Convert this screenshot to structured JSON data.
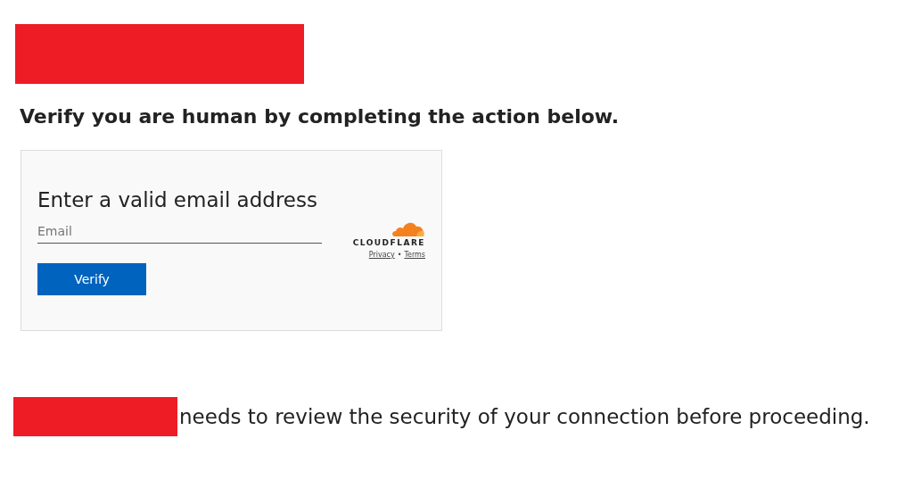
{
  "heading": "Verify you are human by completing the action below.",
  "widget": {
    "title": "Enter a valid email address",
    "email_field": {
      "placeholder": "Email"
    },
    "button": "Verify",
    "brand": "CLOUDFLARE",
    "links": [
      "Privacy",
      "Terms"
    ],
    "separator": "•"
  },
  "footer": {
    "text": "needs to review the security of your connection before proceeding."
  }
}
